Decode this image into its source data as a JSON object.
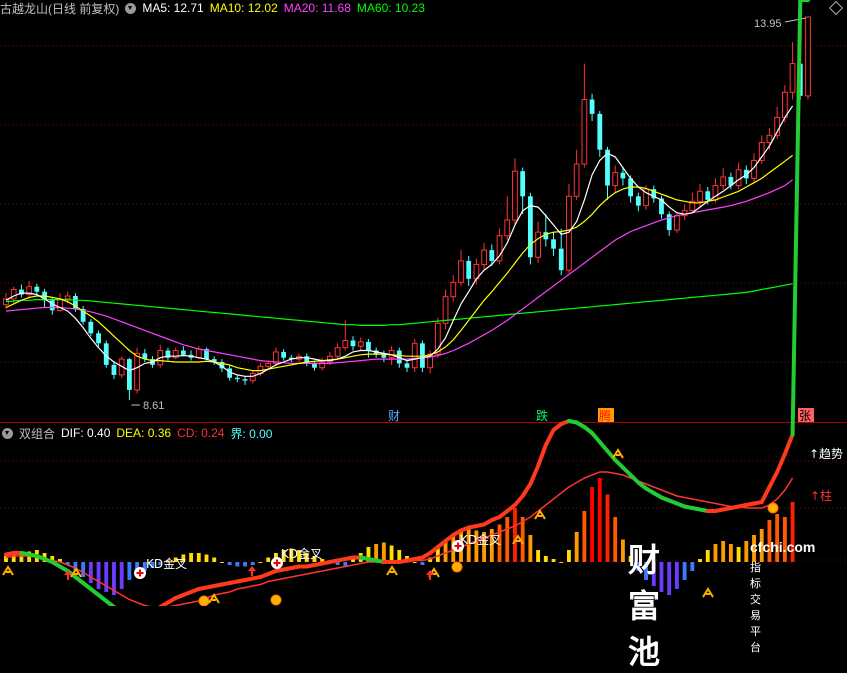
{
  "main_header": {
    "title": "古越龙山(日线 前复权)",
    "ma5": "MA5: 12.71",
    "ma10": "MA10: 12.02",
    "ma20": "MA20: 11.68",
    "ma60": "MA60: 10.23"
  },
  "sub_header": {
    "title": "双组合",
    "dif": "DIF: 0.40",
    "dea": "DEA: 0.36",
    "cd": "CD: 0.24",
    "jie": "界: 0.00"
  },
  "colors": {
    "up": "#ff3232",
    "down": "#54ffff",
    "ma5": "#ffffff",
    "ma10": "#ffff00",
    "ma20": "#ff40ff",
    "ma60": "#00ff00",
    "grid": "#800000",
    "title": "#c0c0c0"
  },
  "annotations": {
    "high": "13.95",
    "low": "8.61",
    "cai": "财",
    "die": "跌",
    "teng": "腾",
    "zhang": "张",
    "kd1": "KD金叉",
    "kd2": "KD金叉",
    "kd3": "KD金叉",
    "trend": "↑趋势",
    "zhu": "↑柱"
  },
  "watermark": {
    "big": "财富池",
    "url": "cfchi.com",
    "sub": "指标交易平台"
  },
  "chart_data": {
    "type": "candlestick",
    "price_range": [
      8.61,
      13.95
    ],
    "candles": [
      [
        9.94,
        10.02,
        10.1,
        9.88
      ],
      [
        10.02,
        10.15,
        10.19,
        9.96
      ],
      [
        10.15,
        10.08,
        10.22,
        10.04
      ],
      [
        10.08,
        10.19,
        10.27,
        10.02
      ],
      [
        10.19,
        10.12,
        10.23,
        10.08
      ],
      [
        10.12,
        10.0,
        10.16,
        9.9
      ],
      [
        10.0,
        9.86,
        10.04,
        9.8
      ],
      [
        9.86,
        10.02,
        10.1,
        9.84
      ],
      [
        10.02,
        10.06,
        10.12,
        9.96
      ],
      [
        10.06,
        9.88,
        10.1,
        9.84
      ],
      [
        9.88,
        9.7,
        9.92,
        9.66
      ],
      [
        9.7,
        9.54,
        9.74,
        9.5
      ],
      [
        9.54,
        9.4,
        9.58,
        9.34
      ],
      [
        9.4,
        9.1,
        9.44,
        9.06
      ],
      [
        9.1,
        8.96,
        9.14,
        8.9
      ],
      [
        8.96,
        9.18,
        9.22,
        8.92
      ],
      [
        9.18,
        8.75,
        9.2,
        8.61
      ],
      [
        8.75,
        9.26,
        9.34,
        8.7
      ],
      [
        9.26,
        9.18,
        9.32,
        9.14
      ],
      [
        9.18,
        9.1,
        9.22,
        9.06
      ],
      [
        9.1,
        9.3,
        9.38,
        9.06
      ],
      [
        9.3,
        9.2,
        9.34,
        9.16
      ],
      [
        9.2,
        9.3,
        9.34,
        9.18
      ],
      [
        9.3,
        9.24,
        9.36,
        9.22
      ],
      [
        9.24,
        9.2,
        9.3,
        9.16
      ],
      [
        9.2,
        9.32,
        9.36,
        9.18
      ],
      [
        9.32,
        9.18,
        9.34,
        9.16
      ],
      [
        9.18,
        9.14,
        9.22,
        9.1
      ],
      [
        9.14,
        9.05,
        9.18,
        9.0
      ],
      [
        9.05,
        8.92,
        9.1,
        8.88
      ],
      [
        8.92,
        8.9,
        8.96,
        8.86
      ],
      [
        8.9,
        8.88,
        8.94,
        8.82
      ],
      [
        8.88,
        8.98,
        9.02,
        8.84
      ],
      [
        8.98,
        9.08,
        9.12,
        8.94
      ],
      [
        9.08,
        9.12,
        9.16,
        9.04
      ],
      [
        9.12,
        9.28,
        9.34,
        9.08
      ],
      [
        9.28,
        9.2,
        9.32,
        9.16
      ],
      [
        9.2,
        9.18,
        9.24,
        9.14
      ],
      [
        9.18,
        9.22,
        9.26,
        9.14
      ],
      [
        9.22,
        9.12,
        9.26,
        9.08
      ],
      [
        9.12,
        9.06,
        9.16,
        9.02
      ],
      [
        9.06,
        9.14,
        9.2,
        9.02
      ],
      [
        9.14,
        9.22,
        9.28,
        9.1
      ],
      [
        9.22,
        9.34,
        9.4,
        9.18
      ],
      [
        9.34,
        9.44,
        9.72,
        9.3
      ],
      [
        9.44,
        9.36,
        9.5,
        9.3
      ],
      [
        9.36,
        9.42,
        9.48,
        9.3
      ],
      [
        9.42,
        9.3,
        9.46,
        9.2
      ],
      [
        9.3,
        9.25,
        9.34,
        9.2
      ],
      [
        9.25,
        9.2,
        9.3,
        9.14
      ],
      [
        9.2,
        9.3,
        9.36,
        9.1
      ],
      [
        9.3,
        9.12,
        9.34,
        9.06
      ],
      [
        9.12,
        9.06,
        9.16,
        9.0
      ],
      [
        9.06,
        9.4,
        9.46,
        9.0
      ],
      [
        9.4,
        9.06,
        9.44,
        9.0
      ],
      [
        9.06,
        9.25,
        9.3,
        8.98
      ],
      [
        9.25,
        9.68,
        9.76,
        9.2
      ],
      [
        9.68,
        10.05,
        10.15,
        9.6
      ],
      [
        10.05,
        10.25,
        10.35,
        9.98
      ],
      [
        10.25,
        10.55,
        10.7,
        10.2
      ],
      [
        10.55,
        10.3,
        10.62,
        10.2
      ],
      [
        10.3,
        10.5,
        10.58,
        10.22
      ],
      [
        10.5,
        10.7,
        10.8,
        10.42
      ],
      [
        10.7,
        10.55,
        10.78,
        10.48
      ],
      [
        10.55,
        10.9,
        11.0,
        10.5
      ],
      [
        10.9,
        11.12,
        11.45,
        10.84
      ],
      [
        11.12,
        11.8,
        11.98,
        11.05
      ],
      [
        11.8,
        11.45,
        11.85,
        11.2
      ],
      [
        11.45,
        10.6,
        11.5,
        10.5
      ],
      [
        10.6,
        10.95,
        11.1,
        10.52
      ],
      [
        10.95,
        10.85,
        11.2,
        10.75
      ],
      [
        10.85,
        10.72,
        10.95,
        10.62
      ],
      [
        10.72,
        10.42,
        11.0,
        10.35
      ],
      [
        10.42,
        11.45,
        11.62,
        10.38
      ],
      [
        11.45,
        11.9,
        12.1,
        11.4
      ],
      [
        11.9,
        12.8,
        13.3,
        11.85
      ],
      [
        12.8,
        12.6,
        12.88,
        12.5
      ],
      [
        12.6,
        12.1,
        12.64,
        12.0
      ],
      [
        12.1,
        11.6,
        12.14,
        11.4
      ],
      [
        11.6,
        11.78,
        11.88,
        11.5
      ],
      [
        11.78,
        11.7,
        11.86,
        11.6
      ],
      [
        11.7,
        11.45,
        11.74,
        11.36
      ],
      [
        11.45,
        11.32,
        11.5,
        11.24
      ],
      [
        11.32,
        11.55,
        11.6,
        11.26
      ],
      [
        11.55,
        11.42,
        11.6,
        11.36
      ],
      [
        11.42,
        11.2,
        11.46,
        11.14
      ],
      [
        11.2,
        10.98,
        11.24,
        10.9
      ],
      [
        10.98,
        11.18,
        11.22,
        10.94
      ],
      [
        11.18,
        11.25,
        11.34,
        11.12
      ],
      [
        11.25,
        11.38,
        11.5,
        11.22
      ],
      [
        11.38,
        11.52,
        11.62,
        11.3
      ],
      [
        11.52,
        11.4,
        11.58,
        11.34
      ],
      [
        11.4,
        11.6,
        11.7,
        11.36
      ],
      [
        11.6,
        11.72,
        11.84,
        11.54
      ],
      [
        11.72,
        11.6,
        11.78,
        11.55
      ],
      [
        11.6,
        11.82,
        11.92,
        11.55
      ],
      [
        11.82,
        11.7,
        11.88,
        11.62
      ],
      [
        11.7,
        11.95,
        12.05,
        11.65
      ],
      [
        11.95,
        12.2,
        12.3,
        11.9
      ],
      [
        12.2,
        12.3,
        12.4,
        12.1
      ],
      [
        12.3,
        12.55,
        12.7,
        12.25
      ],
      [
        12.55,
        12.9,
        13.0,
        12.48
      ],
      [
        12.9,
        13.3,
        13.6,
        12.8
      ],
      [
        13.3,
        12.85,
        13.35,
        12.8
      ],
      [
        12.85,
        13.95,
        13.95,
        12.8
      ]
    ],
    "ma5": [
      10.0,
      10.06,
      10.1,
      10.1,
      10.08,
      10.02,
      9.95,
      9.9,
      9.85,
      9.75,
      9.62,
      9.47,
      9.34,
      9.22,
      9.14,
      9.08,
      9.02,
      9.06,
      9.12,
      9.14,
      9.2,
      9.22,
      9.22,
      9.23,
      9.22,
      9.2,
      9.18,
      9.14,
      9.08,
      9.0,
      8.96,
      8.94,
      8.94,
      8.98,
      9.04,
      9.1,
      9.14,
      9.18,
      9.2,
      9.2,
      9.18,
      9.16,
      9.16,
      9.18,
      9.22,
      9.28,
      9.3,
      9.3,
      9.28,
      9.26,
      9.24,
      9.2,
      9.16,
      9.18,
      9.2,
      9.22,
      9.32,
      9.48,
      9.72,
      9.95,
      10.12,
      10.3,
      10.42,
      10.5,
      10.62,
      10.8,
      11.05,
      11.25,
      11.32,
      11.3,
      11.18,
      11.05,
      10.92,
      10.95,
      11.1,
      11.4,
      11.75,
      11.95,
      12.05,
      12.0,
      11.85,
      11.7,
      11.58,
      11.5,
      11.45,
      11.4,
      11.3,
      11.22,
      11.2,
      11.22,
      11.3,
      11.38,
      11.45,
      11.52,
      11.6,
      11.68,
      11.75,
      11.85,
      12.0,
      12.15,
      12.35,
      12.55,
      12.71
    ],
    "ma10": [
      9.9,
      9.95,
      10.0,
      10.04,
      10.06,
      10.06,
      10.04,
      10.02,
      9.98,
      9.92,
      9.85,
      9.78,
      9.7,
      9.6,
      9.5,
      9.4,
      9.3,
      9.22,
      9.18,
      9.16,
      9.16,
      9.15,
      9.14,
      9.14,
      9.14,
      9.14,
      9.15,
      9.14,
      9.12,
      9.1,
      9.06,
      9.04,
      9.02,
      9.02,
      9.04,
      9.06,
      9.08,
      9.1,
      9.12,
      9.14,
      9.15,
      9.16,
      9.17,
      9.18,
      9.2,
      9.22,
      9.24,
      9.25,
      9.25,
      9.25,
      9.24,
      9.23,
      9.22,
      9.22,
      9.22,
      9.24,
      9.28,
      9.35,
      9.45,
      9.58,
      9.72,
      9.86,
      10.0,
      10.12,
      10.25,
      10.38,
      10.52,
      10.66,
      10.78,
      10.86,
      10.92,
      10.95,
      10.96,
      10.98,
      11.02,
      11.1,
      11.2,
      11.32,
      11.42,
      11.5,
      11.55,
      11.58,
      11.58,
      11.56,
      11.52,
      11.48,
      11.44,
      11.4,
      11.38,
      11.36,
      11.36,
      11.38,
      11.4,
      11.44,
      11.48,
      11.52,
      11.58,
      11.64,
      11.7,
      11.78,
      11.86,
      11.94,
      12.02
    ],
    "ma20": [
      9.85,
      9.86,
      9.87,
      9.88,
      9.89,
      9.9,
      9.9,
      9.9,
      9.89,
      9.88,
      9.86,
      9.84,
      9.81,
      9.78,
      9.74,
      9.7,
      9.66,
      9.62,
      9.58,
      9.54,
      9.5,
      9.46,
      9.42,
      9.38,
      9.35,
      9.32,
      9.3,
      9.28,
      9.26,
      9.24,
      9.22,
      9.2,
      9.18,
      9.16,
      9.15,
      9.14,
      9.13,
      9.12,
      9.12,
      9.12,
      9.12,
      9.12,
      9.12,
      9.13,
      9.14,
      9.15,
      9.16,
      9.17,
      9.18,
      9.18,
      9.18,
      9.18,
      9.18,
      9.19,
      9.2,
      9.21,
      9.23,
      9.26,
      9.3,
      9.35,
      9.4,
      9.46,
      9.52,
      9.58,
      9.65,
      9.72,
      9.8,
      9.88,
      9.96,
      10.04,
      10.12,
      10.2,
      10.28,
      10.36,
      10.44,
      10.52,
      10.6,
      10.68,
      10.76,
      10.84,
      10.9,
      10.96,
      11.0,
      11.04,
      11.08,
      11.12,
      11.15,
      11.18,
      11.2,
      11.22,
      11.24,
      11.26,
      11.28,
      11.3,
      11.32,
      11.35,
      11.38,
      11.42,
      11.46,
      11.5,
      11.55,
      11.6,
      11.68
    ],
    "ma60": [
      9.98,
      9.99,
      10.0,
      10.0,
      10.01,
      10.01,
      10.01,
      10.01,
      10.01,
      10.0,
      10.0,
      9.99,
      9.98,
      9.97,
      9.96,
      9.95,
      9.94,
      9.93,
      9.92,
      9.91,
      9.9,
      9.89,
      9.88,
      9.87,
      9.86,
      9.85,
      9.84,
      9.83,
      9.82,
      9.81,
      9.8,
      9.79,
      9.78,
      9.77,
      9.76,
      9.75,
      9.74,
      9.73,
      9.72,
      9.71,
      9.7,
      9.69,
      9.68,
      9.67,
      9.66,
      9.66,
      9.65,
      9.65,
      9.65,
      9.65,
      9.66,
      9.66,
      9.67,
      9.68,
      9.69,
      9.7,
      9.71,
      9.72,
      9.73,
      9.74,
      9.75,
      9.76,
      9.77,
      9.78,
      9.79,
      9.8,
      9.81,
      9.82,
      9.83,
      9.84,
      9.85,
      9.86,
      9.87,
      9.88,
      9.89,
      9.9,
      9.91,
      9.92,
      9.93,
      9.94,
      9.95,
      9.96,
      9.97,
      9.98,
      9.99,
      10.0,
      10.01,
      10.02,
      10.03,
      10.04,
      10.05,
      10.06,
      10.07,
      10.08,
      10.09,
      10.1,
      10.11,
      10.13,
      10.15,
      10.17,
      10.19,
      10.21,
      10.23
    ],
    "sub_indicator": {
      "name": "双组合",
      "bars": [
        0.04,
        0.06,
        0.05,
        0.07,
        0.08,
        0.06,
        0.04,
        0.02,
        -0.02,
        -0.06,
        -0.1,
        -0.14,
        -0.18,
        -0.2,
        -0.22,
        -0.18,
        -0.12,
        -0.08,
        -0.06,
        -0.04,
        -0.02,
        0.01,
        0.03,
        0.05,
        0.06,
        0.06,
        0.05,
        0.03,
        0.0,
        -0.02,
        -0.03,
        -0.03,
        -0.02,
        0.0,
        0.03,
        0.06,
        0.08,
        0.09,
        0.08,
        0.06,
        0.04,
        0.02,
        0.0,
        -0.02,
        -0.03,
        0.02,
        0.06,
        0.1,
        0.12,
        0.13,
        0.11,
        0.08,
        0.04,
        0.0,
        -0.02,
        0.03,
        0.09,
        0.14,
        0.18,
        0.2,
        0.22,
        0.21,
        0.2,
        0.22,
        0.25,
        0.3,
        0.36,
        0.3,
        0.18,
        0.08,
        0.04,
        0.02,
        0.0,
        0.08,
        0.2,
        0.34,
        0.5,
        0.56,
        0.45,
        0.3,
        0.15,
        0.04,
        -0.06,
        -0.12,
        -0.16,
        -0.2,
        -0.22,
        -0.18,
        -0.12,
        -0.06,
        0.02,
        0.08,
        0.12,
        0.14,
        0.12,
        0.1,
        0.14,
        0.18,
        0.22,
        0.28,
        0.32,
        0.3,
        0.4
      ],
      "dif": [
        0.05,
        0.06,
        0.06,
        0.05,
        0.04,
        0.02,
        0.0,
        -0.03,
        -0.06,
        -0.1,
        -0.14,
        -0.18,
        -0.22,
        -0.26,
        -0.3,
        -0.33,
        -0.35,
        -0.36,
        -0.35,
        -0.33,
        -0.3,
        -0.27,
        -0.24,
        -0.22,
        -0.2,
        -0.18,
        -0.17,
        -0.16,
        -0.15,
        -0.14,
        -0.13,
        -0.12,
        -0.11,
        -0.1,
        -0.08,
        -0.06,
        -0.05,
        -0.04,
        -0.03,
        -0.03,
        -0.02,
        -0.01,
        0.0,
        0.01,
        0.02,
        0.03,
        0.03,
        0.02,
        0.01,
        0.0,
        0.0,
        0.0,
        0.01,
        0.02,
        0.03,
        0.06,
        0.1,
        0.14,
        0.18,
        0.21,
        0.23,
        0.24,
        0.25,
        0.28,
        0.3,
        0.34,
        0.38,
        0.44,
        0.52,
        0.64,
        0.78,
        0.88,
        0.92,
        0.94,
        0.93,
        0.9,
        0.86,
        0.8,
        0.74,
        0.68,
        0.63,
        0.58,
        0.53,
        0.49,
        0.46,
        0.43,
        0.41,
        0.39,
        0.37,
        0.36,
        0.35,
        0.34,
        0.34,
        0.35,
        0.36,
        0.37,
        0.38,
        0.39,
        0.4,
        0.5,
        0.6,
        0.72,
        0.85
      ],
      "dea": [
        0.03,
        0.04,
        0.04,
        0.04,
        0.03,
        0.02,
        0.01,
        0.0,
        -0.02,
        -0.04,
        -0.07,
        -0.1,
        -0.13,
        -0.16,
        -0.19,
        -0.22,
        -0.25,
        -0.27,
        -0.29,
        -0.3,
        -0.3,
        -0.3,
        -0.29,
        -0.28,
        -0.27,
        -0.26,
        -0.24,
        -0.22,
        -0.21,
        -0.2,
        -0.18,
        -0.17,
        -0.16,
        -0.15,
        -0.13,
        -0.12,
        -0.11,
        -0.1,
        -0.09,
        -0.08,
        -0.07,
        -0.06,
        -0.05,
        -0.04,
        -0.03,
        -0.02,
        -0.01,
        0.0,
        0.0,
        0.0,
        0.0,
        0.0,
        0.0,
        0.01,
        0.01,
        0.02,
        0.04,
        0.06,
        0.08,
        0.1,
        0.12,
        0.14,
        0.16,
        0.18,
        0.2,
        0.22,
        0.24,
        0.27,
        0.3,
        0.34,
        0.38,
        0.42,
        0.46,
        0.5,
        0.53,
        0.56,
        0.58,
        0.6,
        0.6,
        0.59,
        0.58,
        0.56,
        0.54,
        0.52,
        0.5,
        0.48,
        0.46,
        0.44,
        0.43,
        0.42,
        0.41,
        0.4,
        0.39,
        0.38,
        0.37,
        0.37,
        0.36,
        0.36,
        0.36,
        0.38,
        0.42,
        0.48,
        0.56
      ]
    }
  }
}
